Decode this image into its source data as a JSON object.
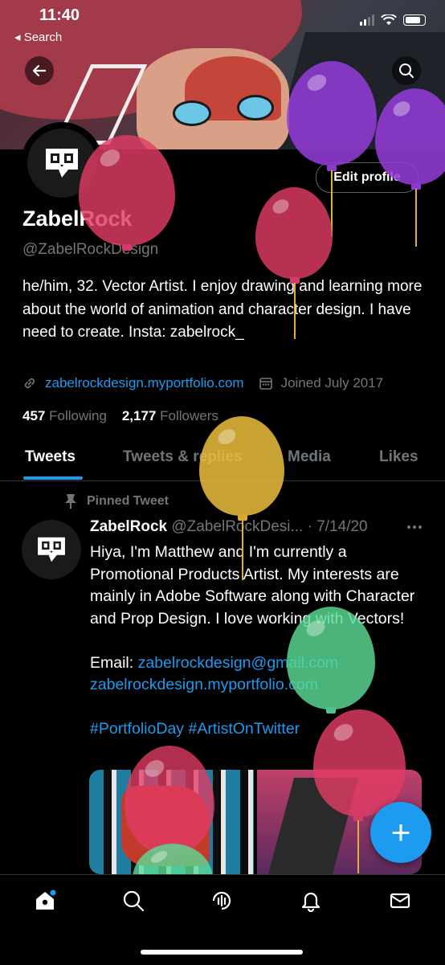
{
  "status_bar": {
    "time": "11:40",
    "back_label": "◂ Search"
  },
  "profile": {
    "display_name": "ZabelRock",
    "handle": "@ZabelRockDesign",
    "bio": "he/him, 32. Vector Artist. I enjoy drawing and learning more about the world of animation and character design. I have need to create. Insta: zabelrock_",
    "website": "zabelrockdesign.myportfolio.com",
    "joined": "Joined July 2017",
    "following_count": "457",
    "following_label": "Following",
    "followers_count": "2,177",
    "followers_label": "Followers",
    "edit_profile_label": "Edit profile"
  },
  "tabs": [
    {
      "label": "Tweets",
      "active": true
    },
    {
      "label": "Tweets & replies",
      "active": false
    },
    {
      "label": "Media",
      "active": false
    },
    {
      "label": "Likes",
      "active": false
    }
  ],
  "pinned_tweet": {
    "pinned_label": "Pinned Tweet",
    "author_name": "ZabelRock",
    "author_handle": "@ZabelRockDesi...",
    "date": "· 7/14/20",
    "text": "Hiya, I'm Matthew and I'm currently a Promotional Products Artist. My interests are mainly in Adobe Software along with Character and Prop Design. I love working with Vectors!",
    "email_label": "Email:",
    "email": "zabelrockdesign@gmail.com",
    "website": "zabelrockdesign.myportfolio.com",
    "hashtags": "#PortfolioDay #ArtistOnTwitter"
  },
  "fab": {
    "label": "+"
  },
  "icons": {
    "back": "arrow-left-icon",
    "search": "search-icon",
    "link": "link-icon",
    "calendar": "calendar-icon",
    "pin": "pin-icon",
    "more": "more-icon",
    "nav": [
      "home-icon",
      "search-icon",
      "spaces-icon",
      "notifications-icon",
      "messages-icon"
    ]
  },
  "colors": {
    "accent": "#1d9bf0",
    "muted": "#71767b",
    "background": "#000000"
  }
}
